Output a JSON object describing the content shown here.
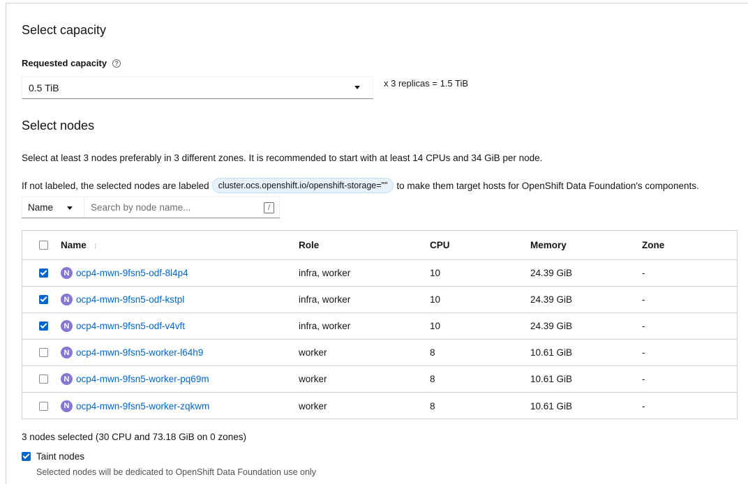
{
  "capacity": {
    "title": "Select capacity",
    "requested_label": "Requested capacity",
    "help_icon": "question-circle-icon",
    "selected_value": "0.5 TiB",
    "replicas_text": "x 3 replicas = 1.5 TiB"
  },
  "nodes": {
    "title": "Select nodes",
    "description": "Select at least 3 nodes preferably in 3 different zones. It is recommended to start with at least 14 CPUs and 34 GiB per node.",
    "label_prefix": "If not labeled, the selected nodes are labeled",
    "label_chip": "cluster.ocs.openshift.io/openshift-storage=\"\"",
    "label_suffix": "to make them target hosts for OpenShift Data Foundation's components.",
    "filter": {
      "type": "Name",
      "placeholder": "Search by node name...",
      "shortcut": "/"
    },
    "table": {
      "columns": [
        "Name",
        "Role",
        "CPU",
        "Memory",
        "Zone"
      ],
      "rows": [
        {
          "checked": true,
          "badge": "N",
          "name": "ocp4-mwn-9fsn5-odf-8l4p4",
          "role": "infra, worker",
          "cpu": "10",
          "memory": "24.39 GiB",
          "zone": "-"
        },
        {
          "checked": true,
          "badge": "N",
          "name": "ocp4-mwn-9fsn5-odf-kstpl",
          "role": "infra, worker",
          "cpu": "10",
          "memory": "24.39 GiB",
          "zone": "-"
        },
        {
          "checked": true,
          "badge": "N",
          "name": "ocp4-mwn-9fsn5-odf-v4vft",
          "role": "infra, worker",
          "cpu": "10",
          "memory": "24.39 GiB",
          "zone": "-"
        },
        {
          "checked": false,
          "badge": "N",
          "name": "ocp4-mwn-9fsn5-worker-l64h9",
          "role": "worker",
          "cpu": "8",
          "memory": "10.61 GiB",
          "zone": "-"
        },
        {
          "checked": false,
          "badge": "N",
          "name": "ocp4-mwn-9fsn5-worker-pq69m",
          "role": "worker",
          "cpu": "8",
          "memory": "10.61 GiB",
          "zone": "-"
        },
        {
          "checked": false,
          "badge": "N",
          "name": "ocp4-mwn-9fsn5-worker-zqkwm",
          "role": "worker",
          "cpu": "8",
          "memory": "10.61 GiB",
          "zone": "-"
        }
      ]
    },
    "summary": "3 nodes selected (30 CPU and 73.18 GiB on 0 zones)",
    "taint": {
      "checked": true,
      "label": "Taint nodes",
      "description": "Selected nodes will be dedicated to OpenShift Data Foundation use only"
    }
  },
  "colors": {
    "link": "#0066cc",
    "checkbox_checked": "#0066cc",
    "node_badge": "#8476d1",
    "chip_bg": "#e7f1fa"
  }
}
